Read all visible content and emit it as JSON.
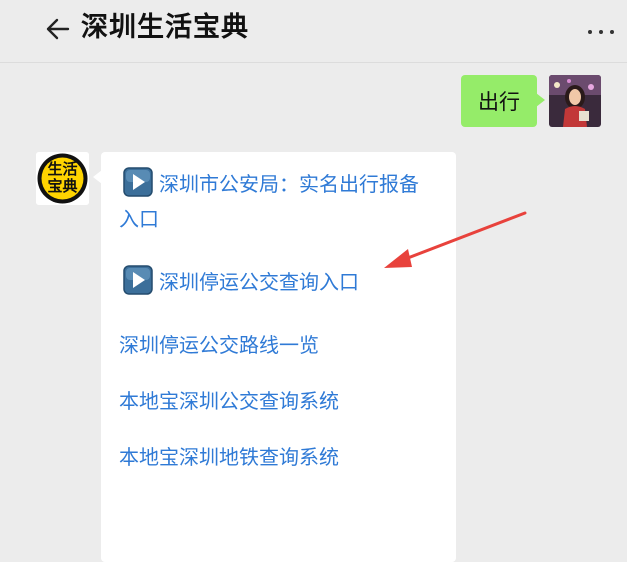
{
  "header": {
    "title": "深圳生活宝典"
  },
  "chat": {
    "user_message": "出行",
    "bot_avatar_text_top": "生活",
    "bot_avatar_text_bottom": "宝典",
    "links": [
      {
        "label_line1": "深圳市公安局：实名出行报备",
        "label_line2": "入口",
        "icon": "play-icon"
      },
      {
        "label": "深圳停运公交查询入口",
        "icon": "play-icon"
      },
      {
        "label": "深圳停运公交路线一览"
      },
      {
        "label": "本地宝深圳公交查询系统"
      },
      {
        "label": "本地宝深圳地铁查询系统"
      }
    ]
  },
  "colors": {
    "link": "#2f7ad6",
    "user_bubble": "#95ec69",
    "arrow": "#e8423c"
  }
}
